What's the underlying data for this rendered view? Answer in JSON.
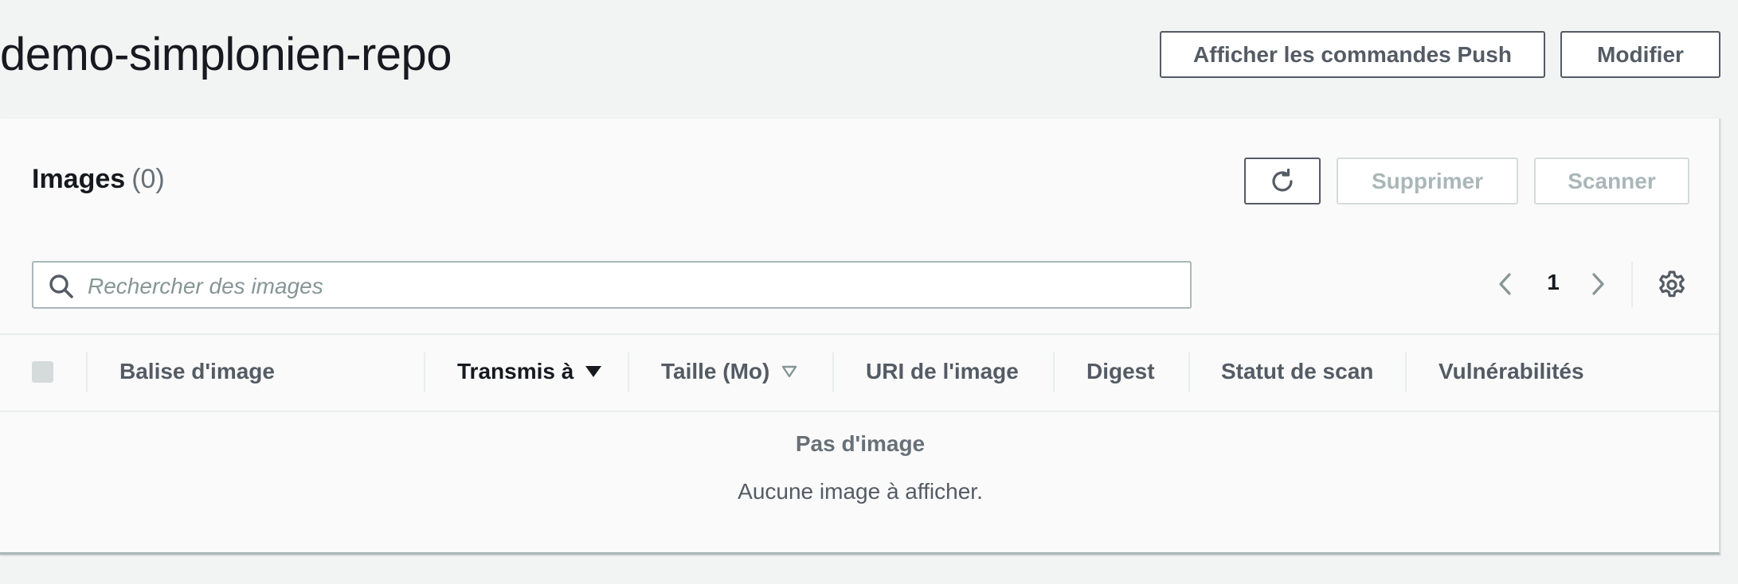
{
  "header": {
    "title": "demo-simplonien-repo",
    "push_commands_label": "Afficher les commandes Push",
    "edit_label": "Modifier"
  },
  "images_panel": {
    "heading": "Images",
    "count": "(0)",
    "refresh_icon": "refresh-icon",
    "delete_label": "Supprimer",
    "scan_label": "Scanner",
    "search": {
      "placeholder": "Rechercher des images",
      "icon": "search-icon"
    },
    "pagination": {
      "current_page": "1",
      "prev_icon": "chevron-left-icon",
      "next_icon": "chevron-right-icon"
    },
    "settings_icon": "gear-icon"
  },
  "table": {
    "columns": [
      {
        "label": "Balise d'image",
        "sort": "none"
      },
      {
        "label": "Transmis à",
        "sort": "descending"
      },
      {
        "label": "Taille (Mo)",
        "sort": "sortable"
      },
      {
        "label": "URI de l'image",
        "sort": "none"
      },
      {
        "label": "Digest",
        "sort": "none"
      },
      {
        "label": "Statut de scan",
        "sort": "none"
      },
      {
        "label": "Vulnérabilités",
        "sort": "none"
      }
    ],
    "empty_title": "Pas d'image",
    "empty_message": "Aucune image à afficher."
  },
  "colors": {
    "background": "#f2f3f3",
    "panel": "#fafafa",
    "border_dark": "#545b64",
    "disabled": "#aab7b8",
    "text": "#16191f"
  }
}
